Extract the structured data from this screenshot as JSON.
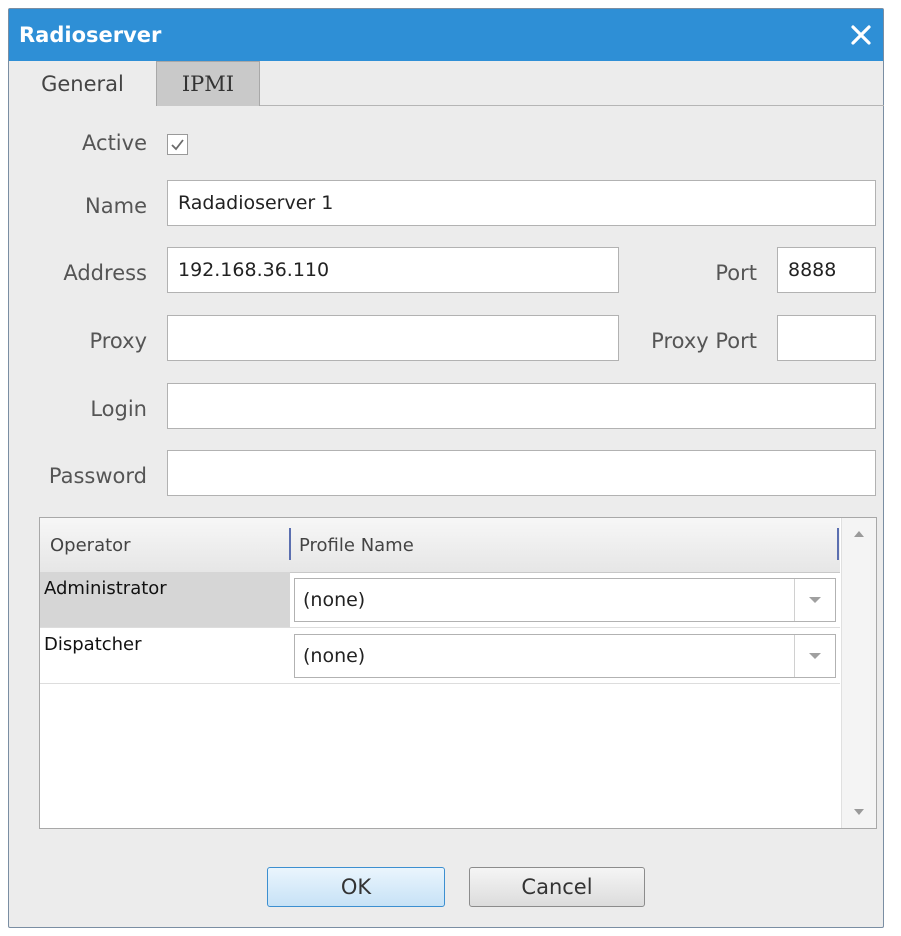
{
  "window": {
    "title": "Radioserver",
    "close_icon": "close-icon"
  },
  "tabs": [
    {
      "label": "General",
      "active": true
    },
    {
      "label": "IPMI",
      "active": false
    }
  ],
  "form": {
    "active_label": "Active",
    "active_checked": true,
    "name_label": "Name",
    "name_value": "Radadioserver 1",
    "address_label": "Address",
    "address_value": "192.168.36.110",
    "port_label": "Port",
    "port_value": "8888",
    "proxy_label": "Proxy",
    "proxy_value": "",
    "proxy_port_label": "Proxy Port",
    "proxy_port_value": "",
    "login_label": "Login",
    "login_value": "",
    "password_label": "Password",
    "password_value": ""
  },
  "grid": {
    "columns": [
      "Operator",
      "Profile Name"
    ],
    "rows": [
      {
        "operator": "Administrator",
        "profile": "(none)",
        "selected": true
      },
      {
        "operator": "Dispatcher",
        "profile": "(none)",
        "selected": false
      }
    ]
  },
  "buttons": {
    "ok": "OK",
    "cancel": "Cancel"
  },
  "colors": {
    "titlebar": "#2e8fd6",
    "ok_border": "#3c8fd0"
  }
}
